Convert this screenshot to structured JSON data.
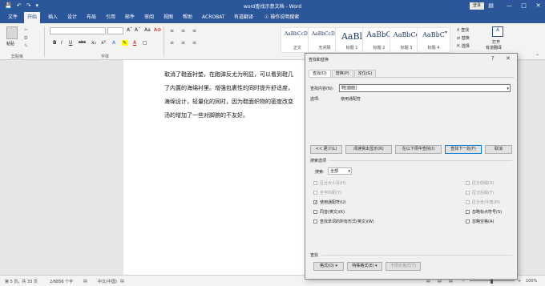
{
  "window": {
    "title": "word查找示意文档 - Word",
    "signin": "登录"
  },
  "qat": {
    "save_icon": "save-icon",
    "undo_icon": "undo-icon",
    "redo_icon": "redo-icon",
    "customize_icon": "chevron-down-icon"
  },
  "tabs": [
    "文件",
    "开始",
    "插入",
    "设计",
    "布局",
    "引用",
    "邮件",
    "审阅",
    "视图",
    "帮助",
    "ACROBAT",
    "有道翻译",
    "操作说明搜索"
  ],
  "ribbon": {
    "groups": {
      "clipboard": "剪贴板",
      "font": "字体"
    },
    "paste_label": "粘贴",
    "font_buttons": [
      "B",
      "I",
      "U",
      "abc",
      "x₂",
      "x²",
      "A",
      "A"
    ],
    "styles": [
      {
        "sample": "AaBbCcDc",
        "name": "正文"
      },
      {
        "sample": "AaBbCcDc",
        "name": "无间隔"
      },
      {
        "sample": "AaBl",
        "name": "标题 1"
      },
      {
        "sample": "AaBbC",
        "name": "标题 2"
      },
      {
        "sample": "AaBbCc",
        "name": "标题 3"
      },
      {
        "sample": "AaBbC",
        "name": "标题 4"
      }
    ],
    "editing": {
      "find": "查找",
      "replace": "替换",
      "select": "选择"
    },
    "translate": {
      "line1": "打开",
      "line2": "有道翻译"
    }
  },
  "document": {
    "lines": [
      "取消了鞋面衬垫，在跑弹反尤为明显，可以看到鞋几",
      "了内置的海绵衬里。增强包裹性的同时提升舒适度，",
      "海绵设计，轻量化的同时，因为鞋面织物的密度改变",
      "汤的增加了一些对脚腕的不友好。"
    ]
  },
  "dialog": {
    "title": "查找和替换",
    "help": "?",
    "close": "✕",
    "tabs": [
      "查找(D)",
      "替换(P)",
      "定位(G)"
    ],
    "find_label": "查找内容(N):",
    "find_value": "鞋[面面]",
    "options_label": "选项:",
    "options_value": "使用通配符",
    "buttons": {
      "less": "<< 更少(L)",
      "reading_highlight": "阅读突出显示(R)",
      "find_in": "在以下项中查找(I)",
      "find_next": "查找下一处(F)",
      "cancel": "取消"
    },
    "search_options_title": "搜索选项",
    "search_label": "搜索:",
    "search_value": "全部",
    "left_options": [
      {
        "label": "区分大小写(H)",
        "checked": false,
        "disabled": true
      },
      {
        "label": "全字匹配(Y)",
        "checked": false,
        "disabled": true
      },
      {
        "label": "使用通配符(U)",
        "checked": true,
        "disabled": false
      },
      {
        "label": "同音(英文)(K)",
        "checked": false,
        "disabled": false
      },
      {
        "label": "查找单词的所有形式(英文)(W)",
        "checked": false,
        "disabled": false
      }
    ],
    "right_options": [
      {
        "label": "区分前缀(X)",
        "checked": false,
        "disabled": true
      },
      {
        "label": "区分后缀(T)",
        "checked": false,
        "disabled": true
      },
      {
        "label": "区分全/半角(M)",
        "checked": false,
        "disabled": true
      },
      {
        "label": "忽略标点符号(S)",
        "checked": false,
        "disabled": false
      },
      {
        "label": "忽略空格(A)",
        "checked": false,
        "disabled": false
      }
    ],
    "find_section_title": "查找",
    "bottom_buttons": {
      "format": "格式(O) ▾",
      "special": "特殊格式(E) ▾",
      "no_format": "不限定格式(T)"
    }
  },
  "status": {
    "page": "第 5 页，共 33 页",
    "words": "2/6856 个字",
    "lang": "中文(中国)",
    "zoom": "100%"
  },
  "colors": {
    "accent": "#2b579a"
  }
}
